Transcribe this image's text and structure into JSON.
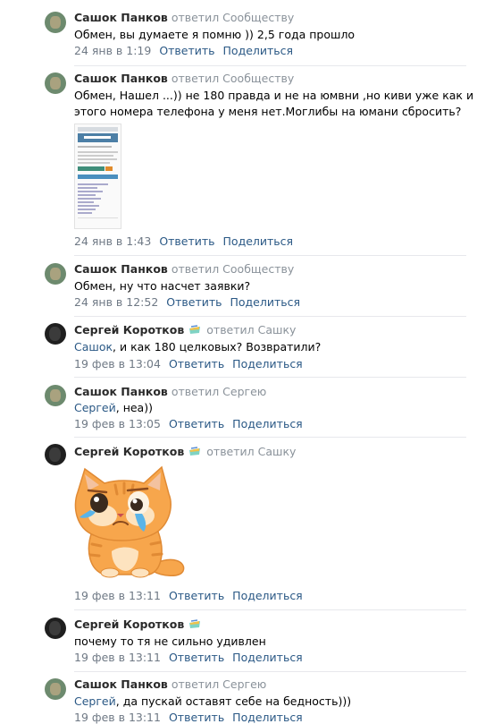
{
  "comments": [
    {
      "author": "Сашок Панков",
      "replied": "ответил Сообществу",
      "text": "Обмен, вы думаете я помню )) 2,5 года прошло",
      "date": "24 янв в 1:19",
      "reply_label": "Ответить",
      "share_label": "Поделиться",
      "avatar": "avatar-sashok"
    },
    {
      "author": "Сашок Панков",
      "replied": "ответил Сообществу",
      "text_line1": "Обмен, Нашел ...)) не 180 правда и не на юмвни ,но киви уже как и",
      "text_line2": "этого номера телефона у меня нет.Моглибы на юмани сбросить?",
      "attachment": "screenshot-image",
      "date": "24 янв в 1:43",
      "reply_label": "Ответить",
      "share_label": "Поделиться",
      "avatar": "avatar-sashok"
    },
    {
      "author": "Сашок Панков",
      "replied": "ответил Сообществу",
      "text": "Обмен, ну что насчет заявки?",
      "date": "24 янв в 12:52",
      "reply_label": "Ответить",
      "share_label": "Поделиться",
      "avatar": "avatar-sashok"
    },
    {
      "author": "Сергей Коротков",
      "replied": "ответил Сашку",
      "mention": "Сашок",
      "text": ", и как 180 целковых? Возвратили?",
      "date": "19 фев в 13:04",
      "reply_label": "Ответить",
      "share_label": "Поделиться",
      "avatar": "avatar-sergey",
      "badge": "verified-icon"
    },
    {
      "author": "Сашок Панков",
      "replied": "ответил Сергею",
      "mention": "Сергей",
      "text": ", неа))",
      "date": "19 фев в 13:05",
      "reply_label": "Ответить",
      "share_label": "Поделиться",
      "avatar": "avatar-sashok"
    },
    {
      "author": "Сергей Коротков",
      "replied": "ответил Сашку",
      "sticker": "crying-cat-sticker",
      "date": "19 фев в 13:11",
      "reply_label": "Ответить",
      "share_label": "Поделиться",
      "avatar": "avatar-sergey",
      "badge": "verified-icon"
    },
    {
      "author": "Сергей Коротков",
      "replied": "",
      "text": "почему то тя не сильно удивлен",
      "date": "19 фев в 13:11",
      "reply_label": "Ответить",
      "share_label": "Поделиться",
      "avatar": "avatar-sergey",
      "badge": "verified-icon"
    },
    {
      "author": "Сашок Панков",
      "replied": "ответил Сергею",
      "mention": "Сергей",
      "text": ", да пускай оставят себе на бедность)))",
      "date": "19 фев в 13:11",
      "reply_label": "Ответить",
      "share_label": "Поделиться",
      "avatar": "avatar-sashok"
    }
  ],
  "colors": {
    "link": "#2a5885",
    "meta": "#6f7985",
    "divider": "#e7e8ec",
    "sticker_orange": "#f7a64c"
  }
}
